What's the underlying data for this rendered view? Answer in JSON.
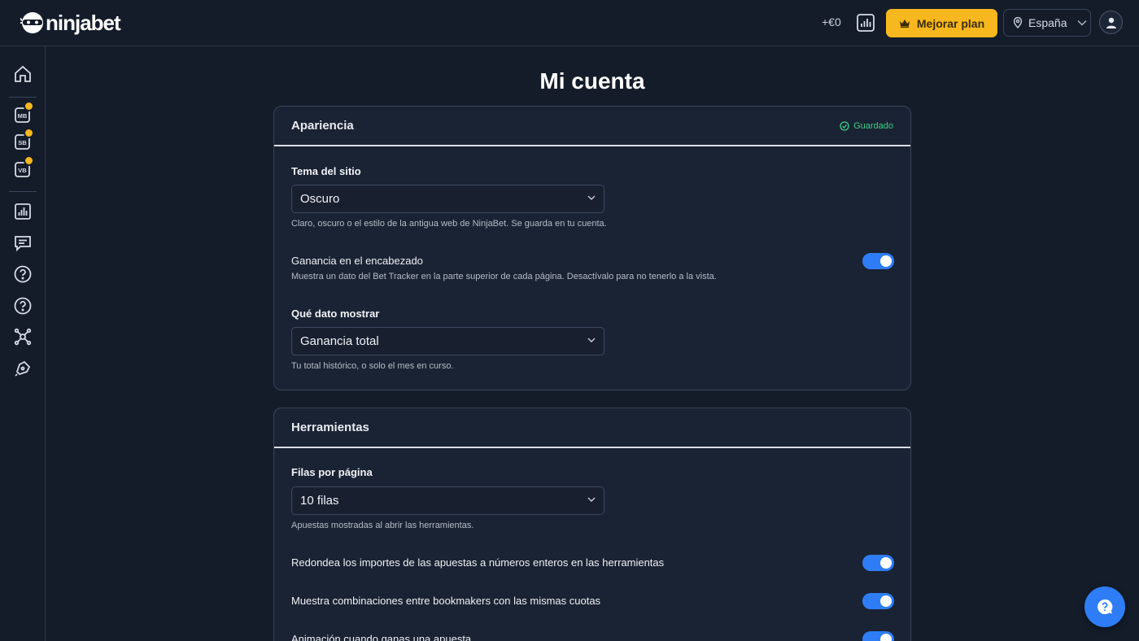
{
  "header": {
    "logo_text": "ninjabet",
    "profit": "+€0",
    "upgrade_label": "Mejorar plan",
    "country": "España"
  },
  "page": {
    "title": "Mi cuenta"
  },
  "appearance": {
    "title": "Apariencia",
    "saved": "Guardado",
    "theme_label": "Tema del sitio",
    "theme_value": "Oscuro",
    "theme_help": "Claro, oscuro o el estilo de la antigua web de NinjaBet. Se guarda en tu cuenta.",
    "header_gain_label": "Ganancia en el encabezado",
    "header_gain_help": "Muestra un dato del Bet Tracker en la parte superior de cada página. Desactívalo para no tenerlo a la vista.",
    "header_gain_on": true,
    "data_label": "Qué dato mostrar",
    "data_value": "Ganancia total",
    "data_help": "Tu total histórico, o solo el mes en curso."
  },
  "tools": {
    "title": "Herramientas",
    "rows_label": "Filas por página",
    "rows_value": "10 filas",
    "rows_help": "Apuestas mostradas al abrir las herramientas.",
    "round_label": "Redondea los importes de las apuestas a números enteros en las herramientas",
    "round_on": true,
    "combos_label": "Muestra combinaciones entre bookmakers con las mismas cuotas",
    "combos_on": true,
    "anim_label": "Animación cuando ganas una apuesta",
    "anim_on": true
  },
  "sidebar": {
    "badges": [
      "MB",
      "SB",
      "VB"
    ]
  },
  "colors": {
    "background": "#141c2a",
    "card": "#1a2333",
    "accent": "#2f7df6",
    "upgrade": "#f7b71e",
    "saved": "#3ccf86"
  }
}
